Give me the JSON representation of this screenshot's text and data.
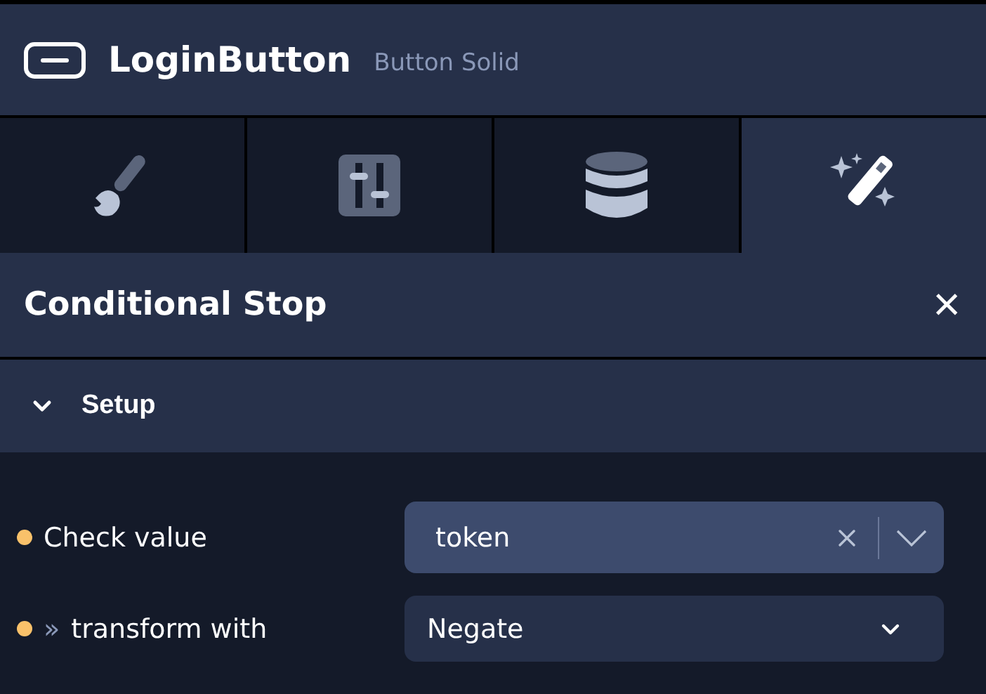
{
  "header": {
    "title": "LoginButton",
    "subtitle": "Button Solid"
  },
  "tabs": [
    {
      "kind": "style",
      "selected": false
    },
    {
      "kind": "controls",
      "selected": false
    },
    {
      "kind": "data",
      "selected": false
    },
    {
      "kind": "actions",
      "selected": true
    }
  ],
  "panel": {
    "title": "Conditional Stop",
    "close": "×"
  },
  "section": {
    "title": "Setup",
    "expanded": true
  },
  "fields": [
    {
      "kind": "combo",
      "label": "Check value",
      "color": "#f9c16a",
      "value": "token"
    },
    {
      "kind": "select",
      "label": "transform with",
      "prefix": "»",
      "color": "#f9c16a",
      "value": "Negate"
    }
  ]
}
